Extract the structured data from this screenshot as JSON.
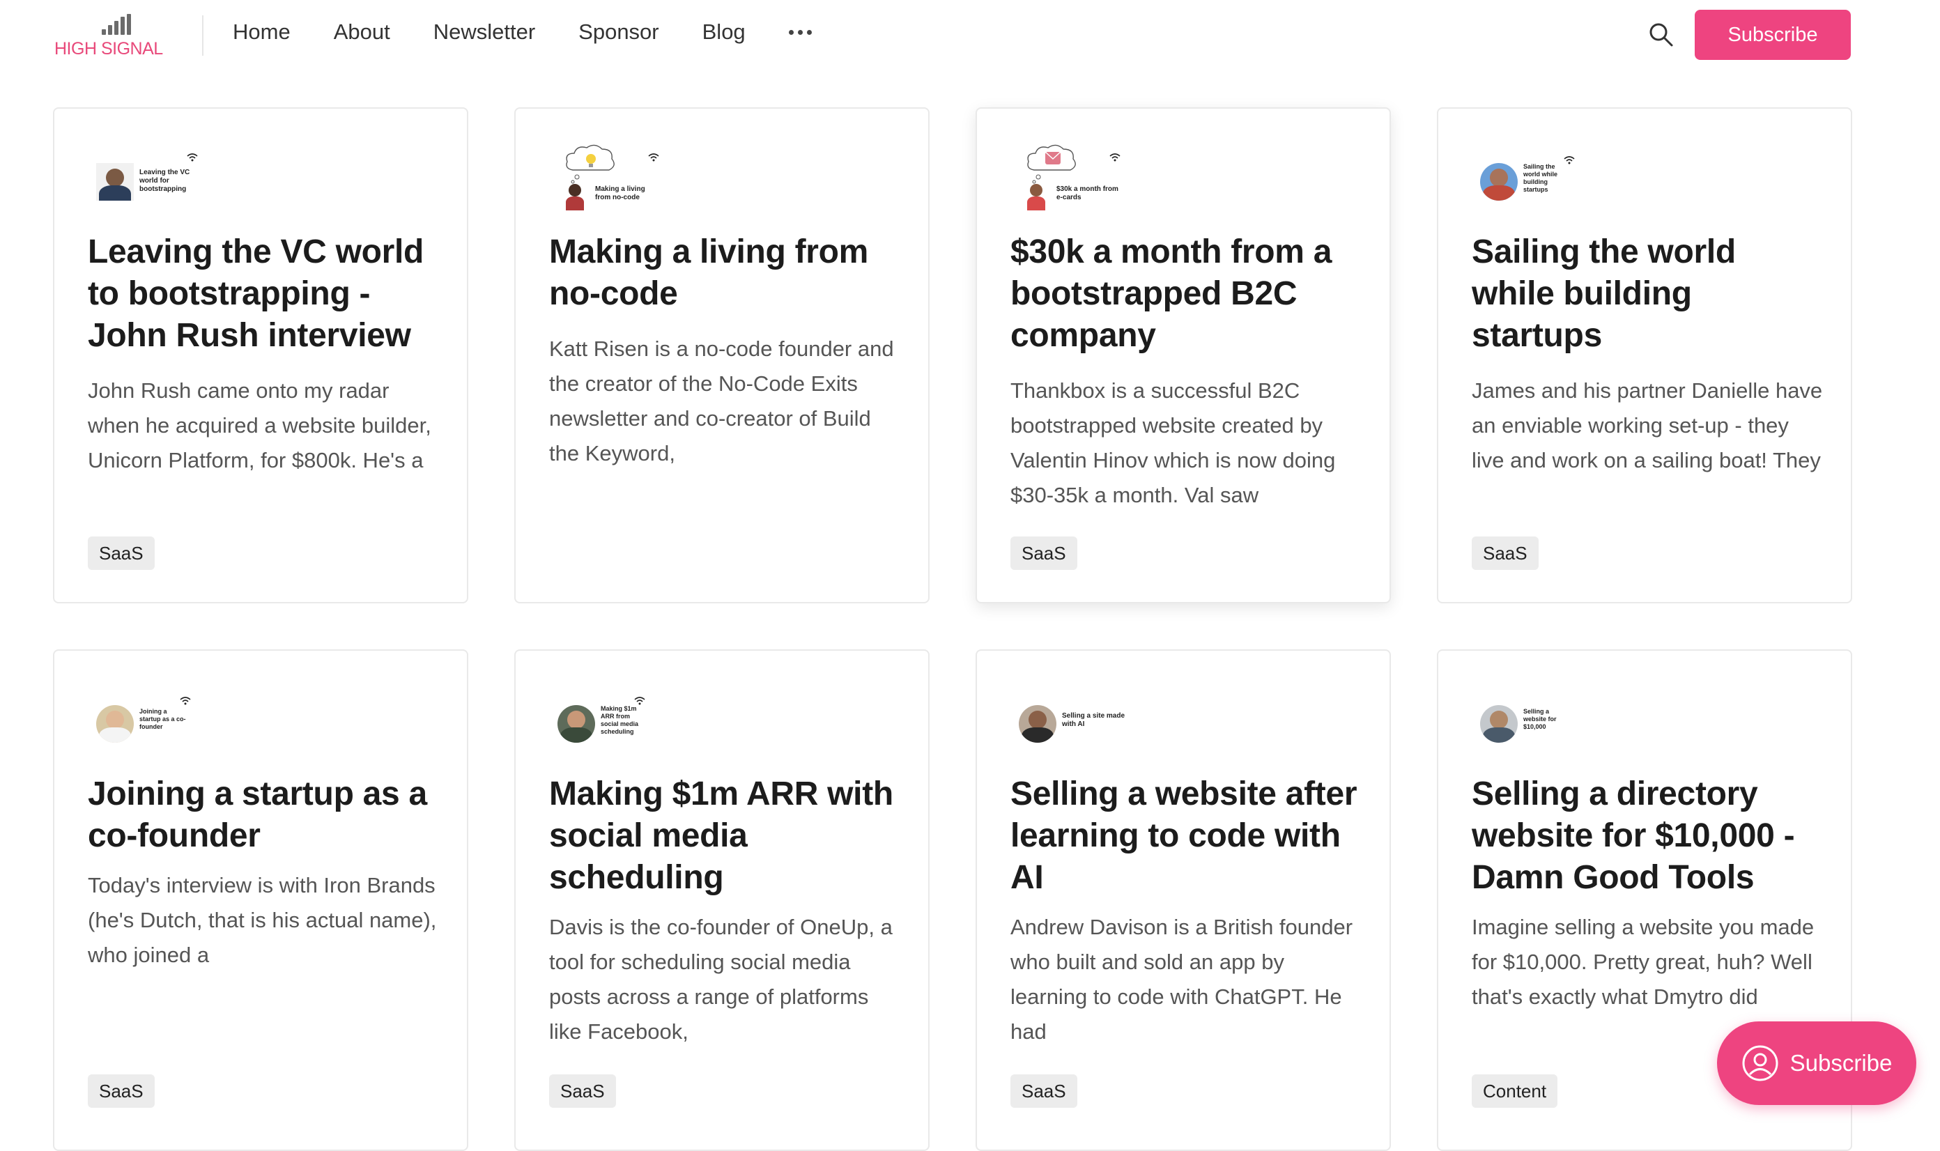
{
  "header": {
    "logo_text": "HIGH SIGNAL",
    "nav": [
      "Home",
      "About",
      "Newsletter",
      "Sponsor",
      "Blog"
    ],
    "more_icon": "ellipsis-icon",
    "search_icon": "search-icon",
    "subscribe_label": "Subscribe"
  },
  "colors": {
    "brand": "#ee4480",
    "logo": "#e8497a",
    "tag_bg": "#ececec"
  },
  "cards": [
    {
      "thumb_caption": "Leaving the VC world for bootstrapping",
      "title": "Leaving the VC world to bootstrapping - John Rush interview",
      "excerpt": "John Rush came onto my radar when he acquired a website builder, Unicorn Platform, for $800k. He's a",
      "tag": "SaaS"
    },
    {
      "thumb_caption": "Making a living from no-code",
      "title": "Making a living from no-code",
      "excerpt": "Katt Risen is a no-code founder and the creator of the No-Code Exits newsletter and co-creator of Build the Keyword,",
      "tag": ""
    },
    {
      "thumb_caption": "$30k a month from e-cards",
      "title": "$30k a month from a bootstrapped B2C company",
      "excerpt": "Thankbox is a successful B2C bootstrapped website created by Valentin Hinov which is now doing $30-35k a month. Val saw",
      "tag": "SaaS"
    },
    {
      "thumb_caption": "Sailing the world while building startups",
      "title": "Sailing the world while building startups",
      "excerpt": "James and his partner Danielle have an enviable working set-up - they live and work on a sailing boat! They",
      "tag": "SaaS"
    },
    {
      "thumb_caption": "Joining a startup as a co-founder",
      "title": "Joining a startup as a co-founder",
      "excerpt": "Today's interview is with Iron Brands (he's Dutch, that is his actual name), who joined a",
      "tag": "SaaS"
    },
    {
      "thumb_caption": "Making $1m ARR from social media scheduling",
      "title": "Making $1m ARR with social media scheduling",
      "excerpt": "Davis is the co-founder of OneUp, a tool for scheduling social media posts across a range of platforms like Facebook,",
      "tag": "SaaS"
    },
    {
      "thumb_caption": "Selling a site made with AI",
      "title": "Selling a website after learning to code with AI",
      "excerpt": "Andrew Davison is a British founder who built and sold an app by learning to code with ChatGPT. He had",
      "tag": "SaaS"
    },
    {
      "thumb_caption": "Selling a website for $10,000",
      "title": "Selling a directory website for $10,000 - Damn Good Tools",
      "excerpt": "Imagine selling a website you made for $10,000. Pretty great, huh? Well that's exactly what Dmytro did",
      "tag": "Content"
    }
  ],
  "float_button": {
    "label": "Subscribe",
    "icon": "user-circle-icon"
  }
}
